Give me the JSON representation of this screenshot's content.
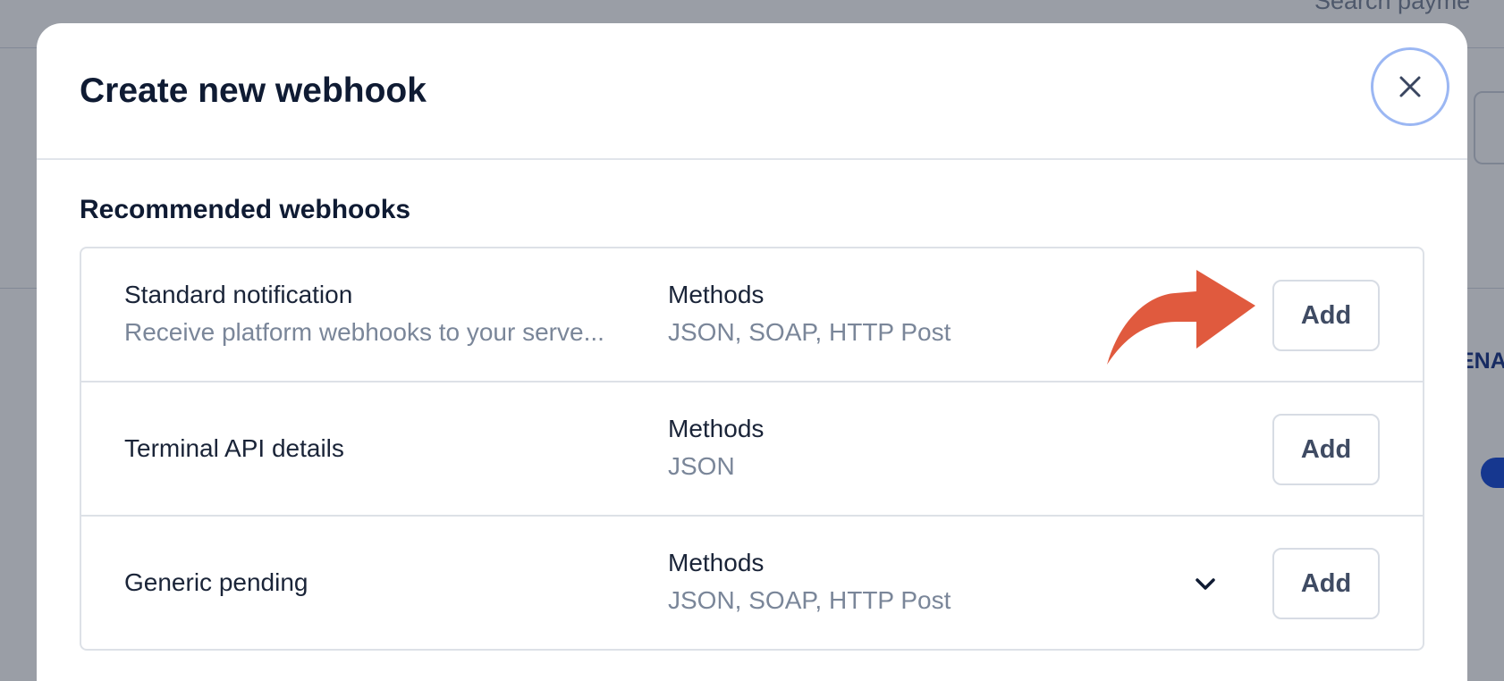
{
  "background": {
    "search_placeholder": "Search payme",
    "column_header": "ENA"
  },
  "modal": {
    "title": "Create new webhook",
    "close_icon": "close-icon",
    "section_title": "Recommended webhooks",
    "webhooks": [
      {
        "name": "Standard notification",
        "description": "Receive platform webhooks to your serve...",
        "methods_label": "Methods",
        "methods": "JSON, SOAP, HTTP Post",
        "add_label": "Add"
      },
      {
        "name": "Terminal API details",
        "methods_label": "Methods",
        "methods": "JSON",
        "add_label": "Add"
      },
      {
        "name": "Generic pending",
        "methods_label": "Methods",
        "methods": "JSON, SOAP, HTTP Post",
        "add_label": "Add",
        "expand_icon": "chevron-down-icon"
      }
    ]
  },
  "colors": {
    "annotation_arrow": "#e05a3e",
    "close_ring": "#9bb7f3",
    "title_text": "#0f1b33",
    "muted_text": "#7a8699",
    "toggle_on": "#1d4ed8"
  }
}
